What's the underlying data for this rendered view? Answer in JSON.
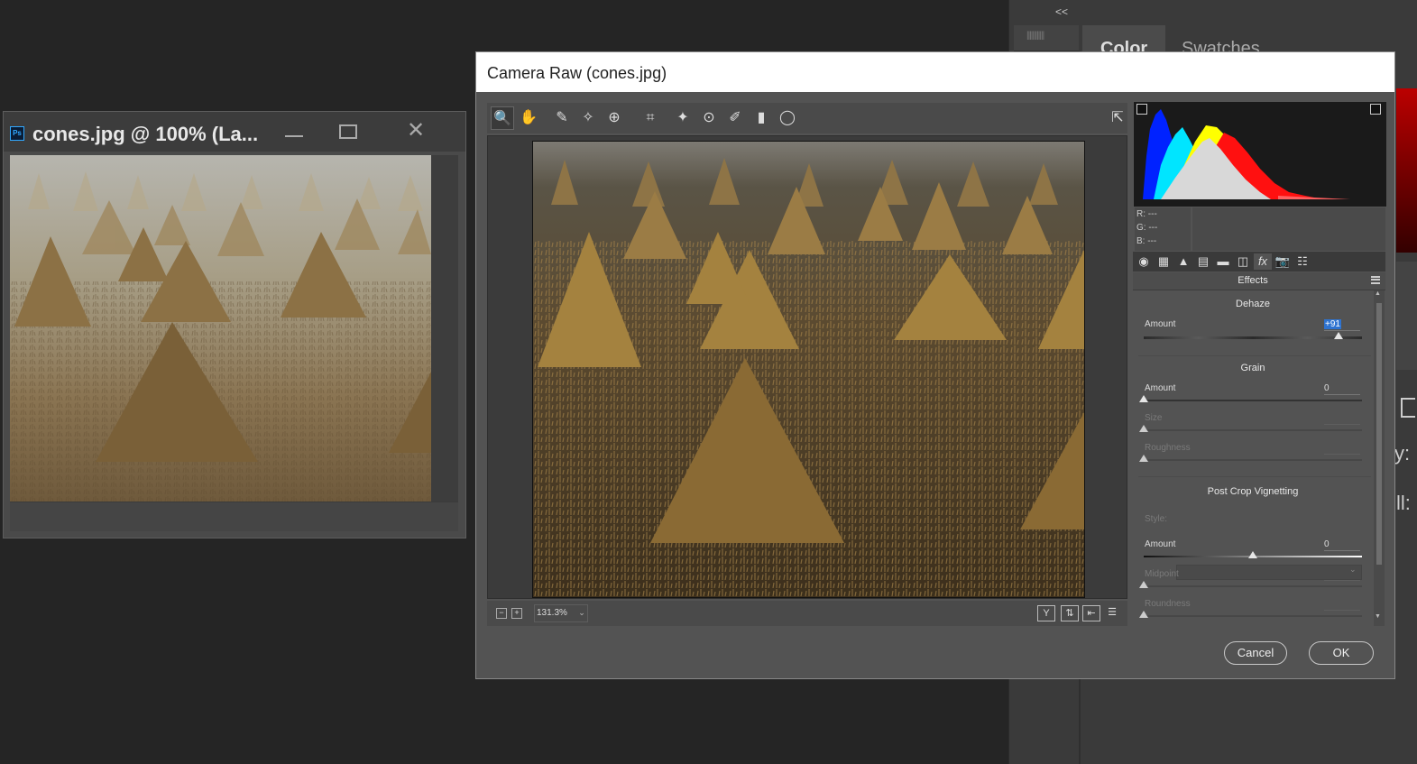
{
  "ps_panel": {
    "collapse_glyph": "<<",
    "tabs": [
      "Color",
      "Swatches"
    ],
    "fragments": [
      "y:",
      "ll:"
    ]
  },
  "document_window": {
    "title": "cones.jpg @ 100% (La...",
    "ps_badge": "Ps",
    "close_glyph": "✕"
  },
  "camera_raw": {
    "title": "Camera Raw (cones.jpg)",
    "tools": [
      {
        "icon": "zoom-tool-icon",
        "glyph": "🔍"
      },
      {
        "icon": "hand-tool-icon",
        "glyph": "✋"
      },
      {
        "icon": "white-balance-icon",
        "glyph": "✎"
      },
      {
        "icon": "color-sampler-icon",
        "glyph": "✧"
      },
      {
        "icon": "targeted-adjustment-icon",
        "glyph": "⊕"
      },
      {
        "icon": "crop-tool-icon",
        "glyph": "⌗"
      },
      {
        "icon": "spot-removal-icon",
        "glyph": "✦"
      },
      {
        "icon": "red-eye-icon",
        "glyph": "⊙"
      },
      {
        "icon": "adjustment-brush-icon",
        "glyph": "✐"
      },
      {
        "icon": "graduated-filter-icon",
        "glyph": "▮"
      },
      {
        "icon": "radial-filter-icon",
        "glyph": "◯"
      }
    ],
    "zoom": {
      "value": "131.3%",
      "zoom_out": "−",
      "zoom_in": "+",
      "arrow": "⌄"
    },
    "view_buttons": [
      {
        "icon": "before-after-icon",
        "glyph": "Y"
      },
      {
        "icon": "swap-settings-icon",
        "glyph": "⇅"
      },
      {
        "icon": "copy-settings-icon",
        "glyph": "⇤"
      },
      {
        "icon": "preview-preferences-icon",
        "glyph": "☰"
      }
    ],
    "readout": {
      "r": "R:   ---",
      "g": "G:   ---",
      "b": "B:   ---"
    },
    "panel_tab_icons": [
      {
        "icon": "basic-tab-icon",
        "glyph": "◉"
      },
      {
        "icon": "tone-curve-tab-icon",
        "glyph": "▦"
      },
      {
        "icon": "detail-tab-icon",
        "glyph": "▲"
      },
      {
        "icon": "hsl-tab-icon",
        "glyph": "▤"
      },
      {
        "icon": "split-toning-tab-icon",
        "glyph": "▬"
      },
      {
        "icon": "lens-corrections-tab-icon",
        "glyph": "◫"
      },
      {
        "icon": "effects-tab-icon",
        "glyph": "fx"
      },
      {
        "icon": "camera-calibration-tab-icon",
        "glyph": "📷"
      },
      {
        "icon": "presets-tab-icon",
        "glyph": "☷"
      }
    ],
    "panel": {
      "header": "Effects",
      "dehaze": {
        "title": "Dehaze",
        "amount_label": "Amount",
        "amount_value": "+91",
        "amount": 91
      },
      "grain": {
        "title": "Grain",
        "amount_label": "Amount",
        "amount_value": "0",
        "size_label": "Size",
        "roughness_label": "Roughness"
      },
      "vignette": {
        "title": "Post Crop Vignetting",
        "style_label": "Style:",
        "amount_label": "Amount",
        "amount_value": "0",
        "midpoint_label": "Midpoint",
        "roundness_label": "Roundness"
      }
    },
    "buttons": {
      "cancel": "Cancel",
      "ok": "OK"
    }
  }
}
